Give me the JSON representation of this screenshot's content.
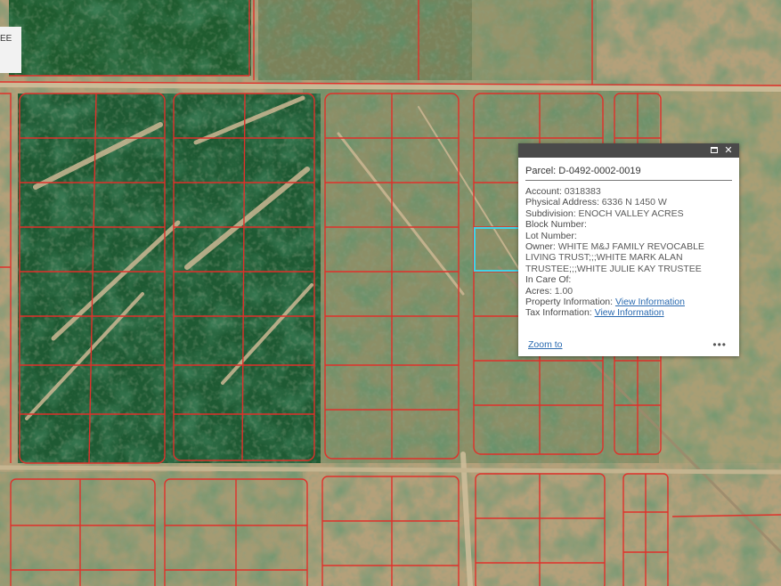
{
  "corner_label": "EE",
  "popup": {
    "title": "Parcel: D-0492-0002-0019",
    "fields": [
      {
        "label": "Account:",
        "value": "0318383"
      },
      {
        "label": "Physical Address:",
        "value": "6336 N 1450 W"
      },
      {
        "label": "Subdivision:",
        "value": "ENOCH VALLEY ACRES"
      },
      {
        "label": "Block Number:",
        "value": ""
      },
      {
        "label": "Lot Number:",
        "value": ""
      },
      {
        "label": "Owner:",
        "value": "WHITE M&J FAMILY REVOCABLE LIVING TRUST;;;WHITE MARK ALAN TRUSTEE;;;WHITE JULIE KAY TRUSTEE"
      },
      {
        "label": "In Care Of:",
        "value": ""
      },
      {
        "label": "Acres:",
        "value": "1.00"
      },
      {
        "label": "Property Information:",
        "link": "View Information"
      },
      {
        "label": "Tax Information:",
        "link": "View Information"
      }
    ],
    "zoom_label": "Zoom to",
    "more_label": "•••"
  },
  "icons": {
    "maximize": "maximize-icon",
    "close": "close-icon",
    "more": "more-icon"
  },
  "colors": {
    "parcel_lines": "#e0302a",
    "selected_parcel": "#40d4e6",
    "popup_header": "#4a4a4a",
    "link": "#2a6ab0"
  }
}
